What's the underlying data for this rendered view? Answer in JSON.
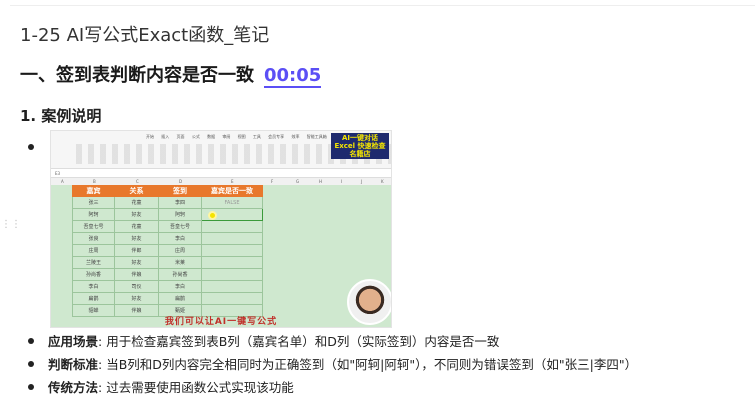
{
  "doc_title": "1-25 AI写公式Exact函数_笔记",
  "section": {
    "heading": "一、签到表判断内容是否一致",
    "timestamp": "00:05"
  },
  "subsection": "1. 案例说明",
  "video": {
    "ribbon_tabs": "开始 插入 页面 公式 数据 审阅 视图 工具 会员专享 效率 智能工具箱",
    "promo_text": "AI一键对话Excel 快速检查名籍店",
    "cell_ref": "E3",
    "columns": [
      "A",
      "B",
      "C",
      "D",
      "E",
      "F",
      "G",
      "H",
      "I",
      "J",
      "K"
    ],
    "table_headers": [
      "嘉宾",
      "关系",
      "签到",
      "嘉宾是否一致"
    ],
    "rows": [
      [
        "张三",
        "花童",
        "李四",
        "FALSE"
      ],
      [
        "阿轲",
        "好友",
        "阿轲",
        ""
      ],
      [
        "吾皇七号",
        "花童",
        "吾皇七号",
        ""
      ],
      [
        "张良",
        "好友",
        "李白",
        ""
      ],
      [
        "庄周",
        "伴郎",
        "庄周",
        ""
      ],
      [
        "兰陵王",
        "好友",
        "米莱",
        ""
      ],
      [
        "孙尚香",
        "伴娘",
        "孙尚香",
        ""
      ],
      [
        "李白",
        "司仪",
        "李白",
        ""
      ],
      [
        "扁鹊",
        "好友",
        "扁鹊",
        ""
      ],
      [
        "貂蝉",
        "伴娘",
        "甄姬",
        ""
      ]
    ],
    "caption": "我们可以让AI一键写公式"
  },
  "bullets": [
    {
      "label": "应用场景",
      "text": ": 用于检查嘉宾签到表B列（嘉宾名单）和D列（实际签到）内容是否一致"
    },
    {
      "label": "判断标准",
      "text": ": 当B列和D列内容完全相同时为正确签到（如\"阿轲|阿轲\"），不同则为错误签到（如\"张三|李四\"）"
    },
    {
      "label": "传统方法",
      "text": ": 过去需要使用函数公式实现该功能"
    }
  ]
}
